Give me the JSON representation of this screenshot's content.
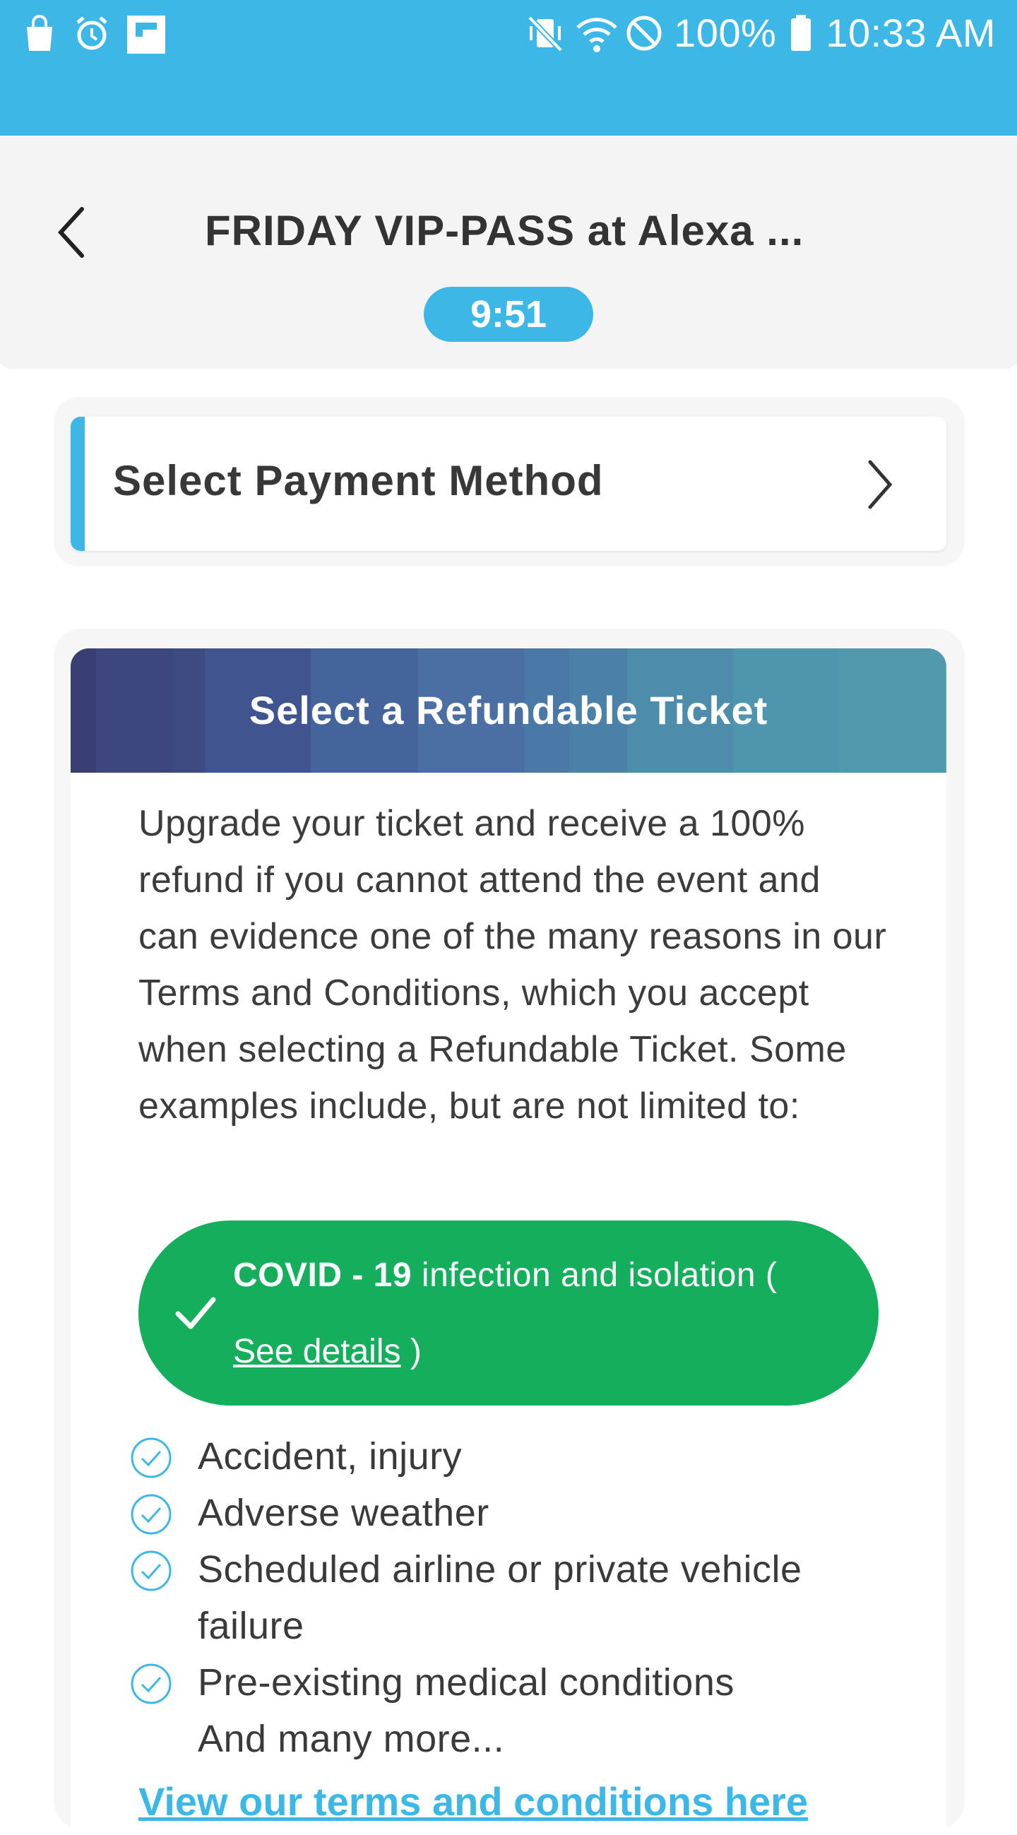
{
  "status_bar": {
    "battery": "100%",
    "time": "10:33 AM",
    "icons": [
      "shopping-bag-icon",
      "alarm-icon",
      "flipboard-icon",
      "vibrate-mute-icon",
      "wifi-icon",
      "do-not-disturb-icon",
      "battery-icon"
    ]
  },
  "header": {
    "title": "FRIDAY VIP-PASS at Alexa ...",
    "timer": "9:51",
    "back_icon": "chevron-left-icon"
  },
  "payment": {
    "label": "Select Payment Method",
    "icon": "chevron-right-icon"
  },
  "refund": {
    "title": "Select a Refundable Ticket",
    "description": "Upgrade your ticket and receive a 100% refund if you cannot attend the event and can evidence one of the many reasons in our Terms and Conditions, which you accept when selecting a Refundable Ticket. Some examples include, but are not limited to:",
    "covid": {
      "bold": "COVID - 19",
      "text": " infection and isolation (",
      "link": "See details",
      "close": " )"
    },
    "reasons": [
      {
        "label": "Accident, injury"
      },
      {
        "label": "Adverse weather"
      },
      {
        "label": "Scheduled airline or private vehicle failure"
      },
      {
        "label": "Pre-existing medical conditions"
      }
    ],
    "more": "And many more...",
    "tc_link": "View our terms and conditions here"
  },
  "colors": {
    "accent": "#3db8e6",
    "covid_green": "#15ae5c",
    "banner_start": "#3d437a",
    "banner_end": "#5baab6"
  }
}
